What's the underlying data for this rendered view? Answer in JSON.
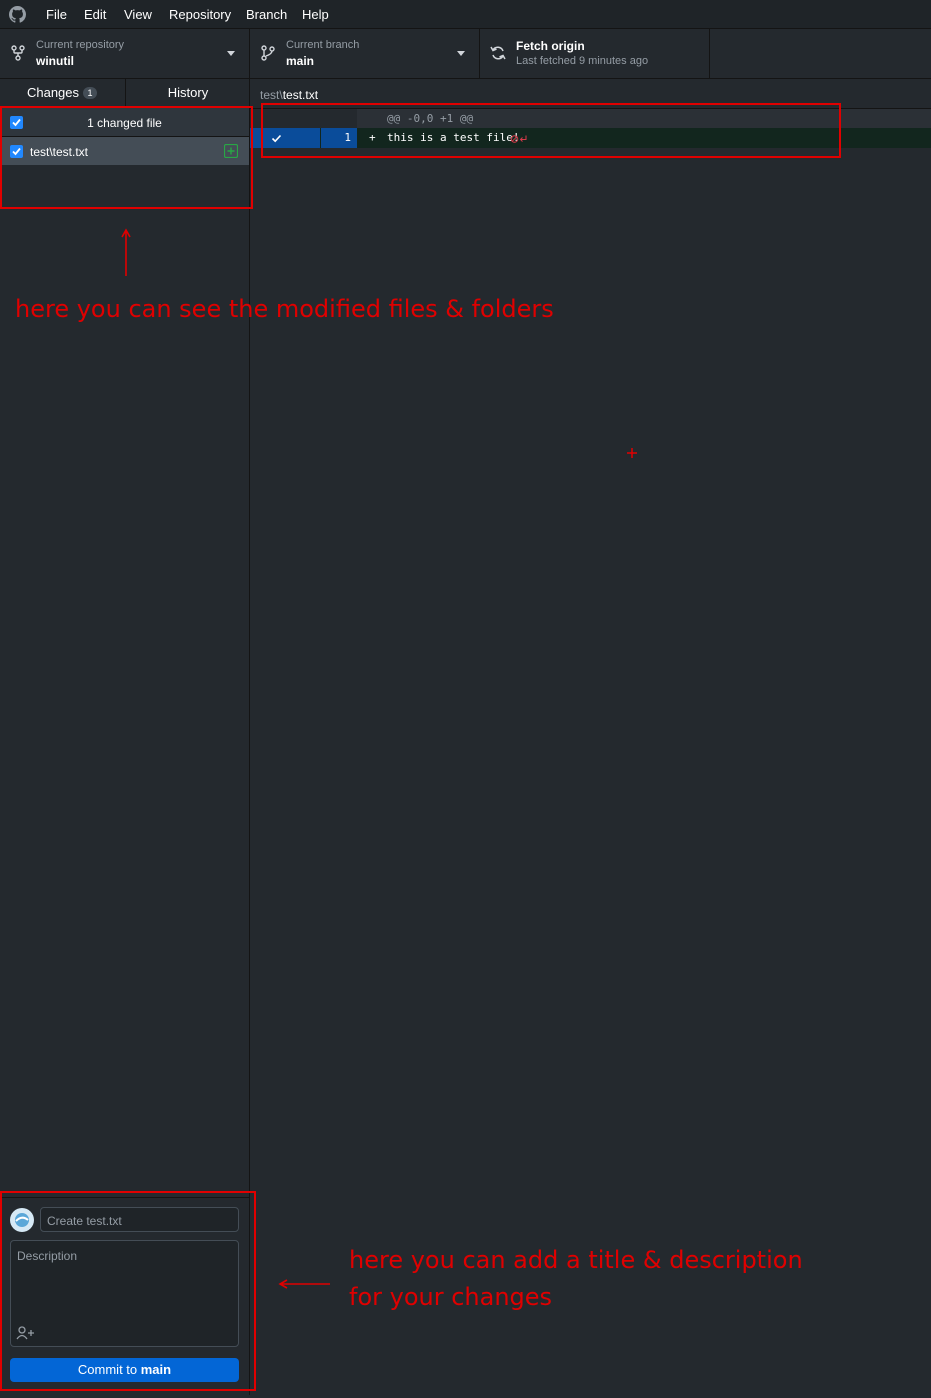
{
  "menubar": {
    "items": [
      "File",
      "Edit",
      "View",
      "Repository",
      "Branch",
      "Help"
    ]
  },
  "toolbar": {
    "repository": {
      "label": "Current repository",
      "value": "winutil"
    },
    "branch": {
      "label": "Current branch",
      "value": "main"
    },
    "fetch": {
      "title": "Fetch origin",
      "subtitle": "Last fetched 9 minutes ago"
    }
  },
  "sidebar": {
    "tabs": [
      {
        "label": "Changes",
        "badge": "1",
        "active": true
      },
      {
        "label": "History",
        "active": false
      }
    ],
    "changed_header": "1 changed file",
    "files": [
      {
        "path": "test\\test.txt",
        "status": "added"
      }
    ]
  },
  "diff": {
    "path_dir": "test\\",
    "path_file": "test.txt",
    "hunk_header": "@@ -0,0 +1 @@",
    "lines": [
      {
        "new_line": "1",
        "marker": "+",
        "text": "this is a test file!"
      }
    ]
  },
  "commit": {
    "summary_placeholder": "Create test.txt",
    "description_placeholder": "Description",
    "button_prefix": "Commit to ",
    "button_branch": "main"
  },
  "annotations": {
    "files_note": "here you can see the modified files & folders",
    "commit_note_line1": "here you can add a title & description",
    "commit_note_line2": "for your changes"
  },
  "colors": {
    "accent": "#2188ff",
    "annotation": "#e00000",
    "added_line": "#12261e",
    "added_icon": "#28a745"
  }
}
